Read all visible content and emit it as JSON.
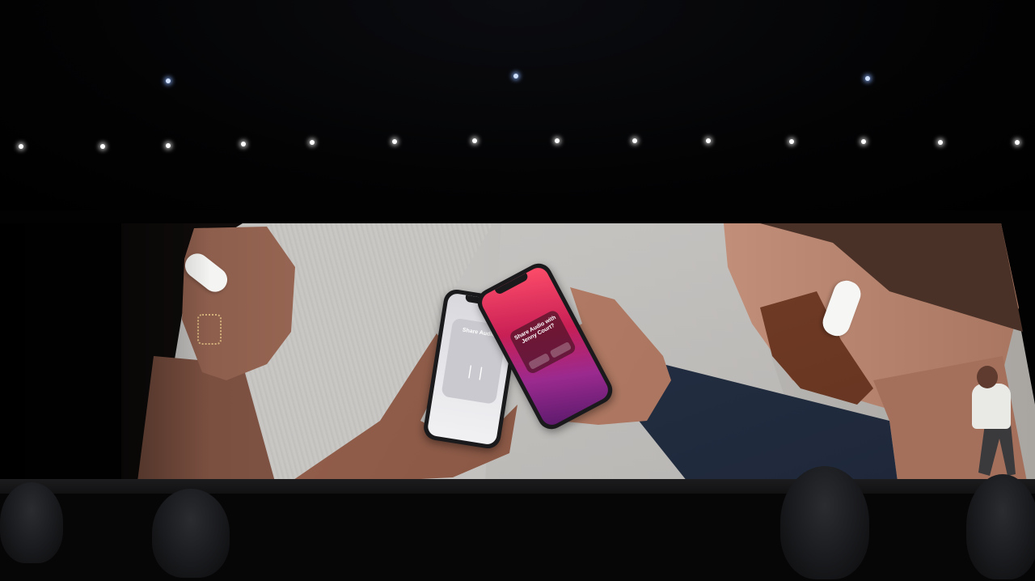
{
  "scene": {
    "description_tag": "keynote-stage",
    "left_phone": {
      "card_title": "Share Audio"
    },
    "right_phone": {
      "popup_title": "Share Audio with Jenny Court?"
    }
  },
  "colors": {
    "background": "#000000",
    "phone_gradient_top": "#ff4e6a",
    "phone_gradient_bottom": "#5b1a6c",
    "presenter_shirt": "#e9e9e6"
  },
  "icons": {
    "airpods": "airpods-icon"
  }
}
